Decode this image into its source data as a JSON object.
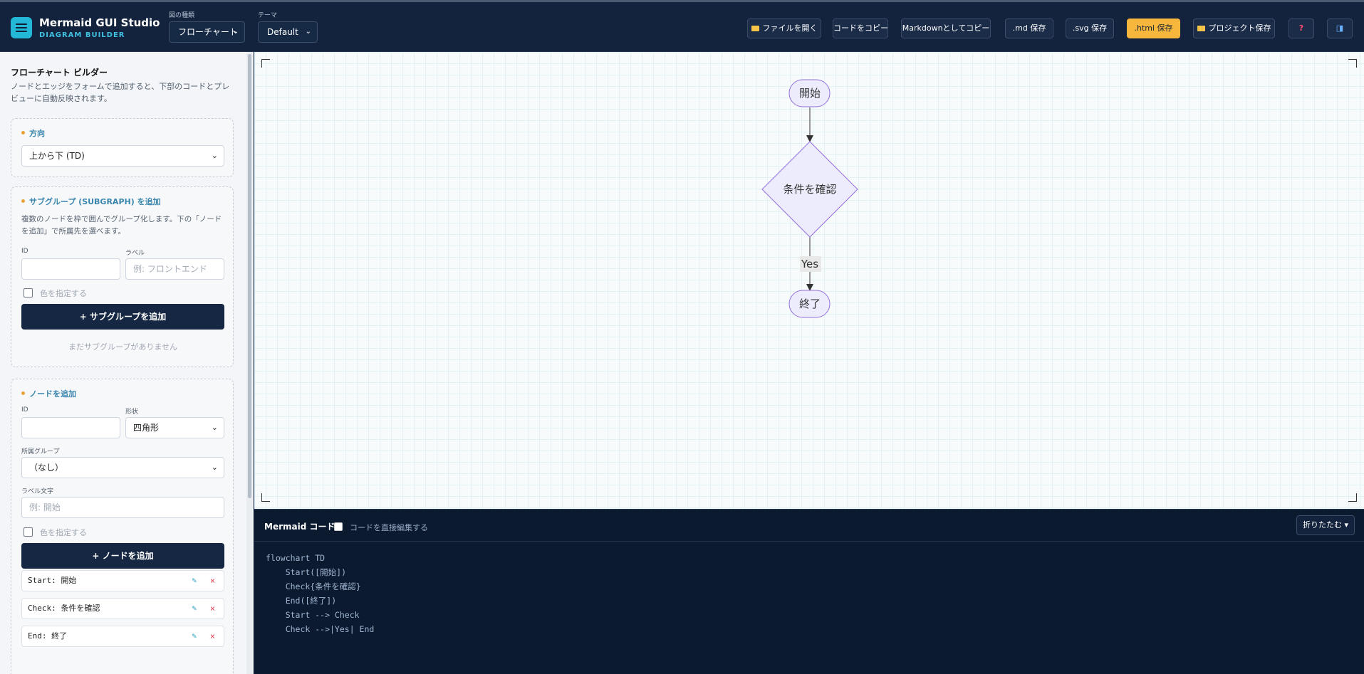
{
  "header": {
    "app_title": "Mermaid GUI Studio",
    "app_subtitle": "DIAGRAM BUILDER",
    "diagram_type_label": "図の種類",
    "diagram_type_value": "フローチャート",
    "theme_label": "テーマ",
    "theme_value": "Default",
    "buttons": {
      "open_file": "ファイルを開く",
      "copy_code": "コードをコピー",
      "copy_markdown": "Markdownとしてコピー",
      "save_md": ".md 保存",
      "save_svg": ".svg 保存",
      "save_html": ".html 保存",
      "save_project": "プロジェクト保存",
      "help": "?",
      "panel_toggle": "◨"
    }
  },
  "sidebar": {
    "title": "フローチャート ビルダー",
    "description": "ノードとエッジをフォームで追加すると、下部のコードとプレビューに自動反映されます。",
    "direction": {
      "heading": "方向",
      "value": "上から下 (TD)"
    },
    "subgraph": {
      "heading": "サブグループ (SUBGRAPH) を追加",
      "description": "複数のノードを枠で囲んでグループ化します。下の「ノードを追加」で所属先を選べます。",
      "id_label": "ID",
      "label_label": "ラベル",
      "id_placeholder": "",
      "label_placeholder": "例: フロントエンド",
      "color_checkbox": "色を指定する",
      "add_button": "+ サブグループを追加",
      "empty_text": "まだサブグループがありません"
    },
    "node": {
      "heading": "ノードを追加",
      "id_label": "ID",
      "shape_label": "形状",
      "shape_value": "四角形",
      "group_label": "所属グループ",
      "group_value": "（なし）",
      "text_label": "ラベル文字",
      "text_placeholder": "例: 開始",
      "color_checkbox": "色を指定する",
      "add_button": "+ ノードを追加",
      "items": [
        {
          "text": "Start: 開始"
        },
        {
          "text": "Check: 条件を確認"
        },
        {
          "text": "End: 終了"
        }
      ],
      "edit_icon": "✎",
      "delete_icon": "×"
    }
  },
  "diagram": {
    "nodes": {
      "start": "開始",
      "check": "条件を確認",
      "end": "終了"
    },
    "edge_label": "Yes"
  },
  "code_panel": {
    "title": "Mermaid コード",
    "direct_edit_label": "コードを直接編集する",
    "fold_label": "折りたたむ ▾",
    "code": "flowchart TD\n    Start([開始])\n    Check{条件を確認}\n    End([終了])\n    Start --> Check\n    Check -->|Yes| End"
  },
  "colors": {
    "header_bg": "#13233d",
    "accent_button": "#f6b73c",
    "brand_cyan": "#22b8d6",
    "node_fill": "#ececfd",
    "node_stroke": "#9370db"
  }
}
